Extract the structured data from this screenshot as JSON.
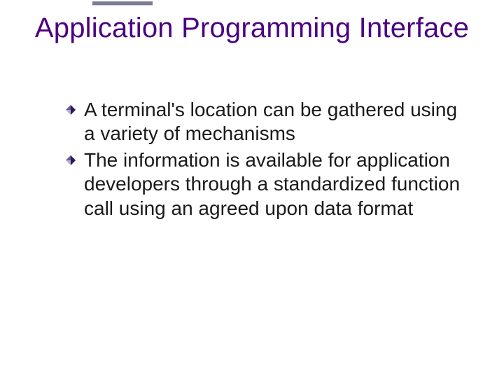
{
  "slide": {
    "title": "Application Programming Interface",
    "bullets": [
      "A terminal's location can be gathered using a variety of mechanisms",
      "The information is available for application developers through a standardized function call using an agreed upon data format"
    ]
  },
  "colors": {
    "title": "#4b0082",
    "bullet_dark": "#2b1a4a",
    "bullet_light": "#b9a8d8",
    "accent_bar": "#7b7b98"
  }
}
